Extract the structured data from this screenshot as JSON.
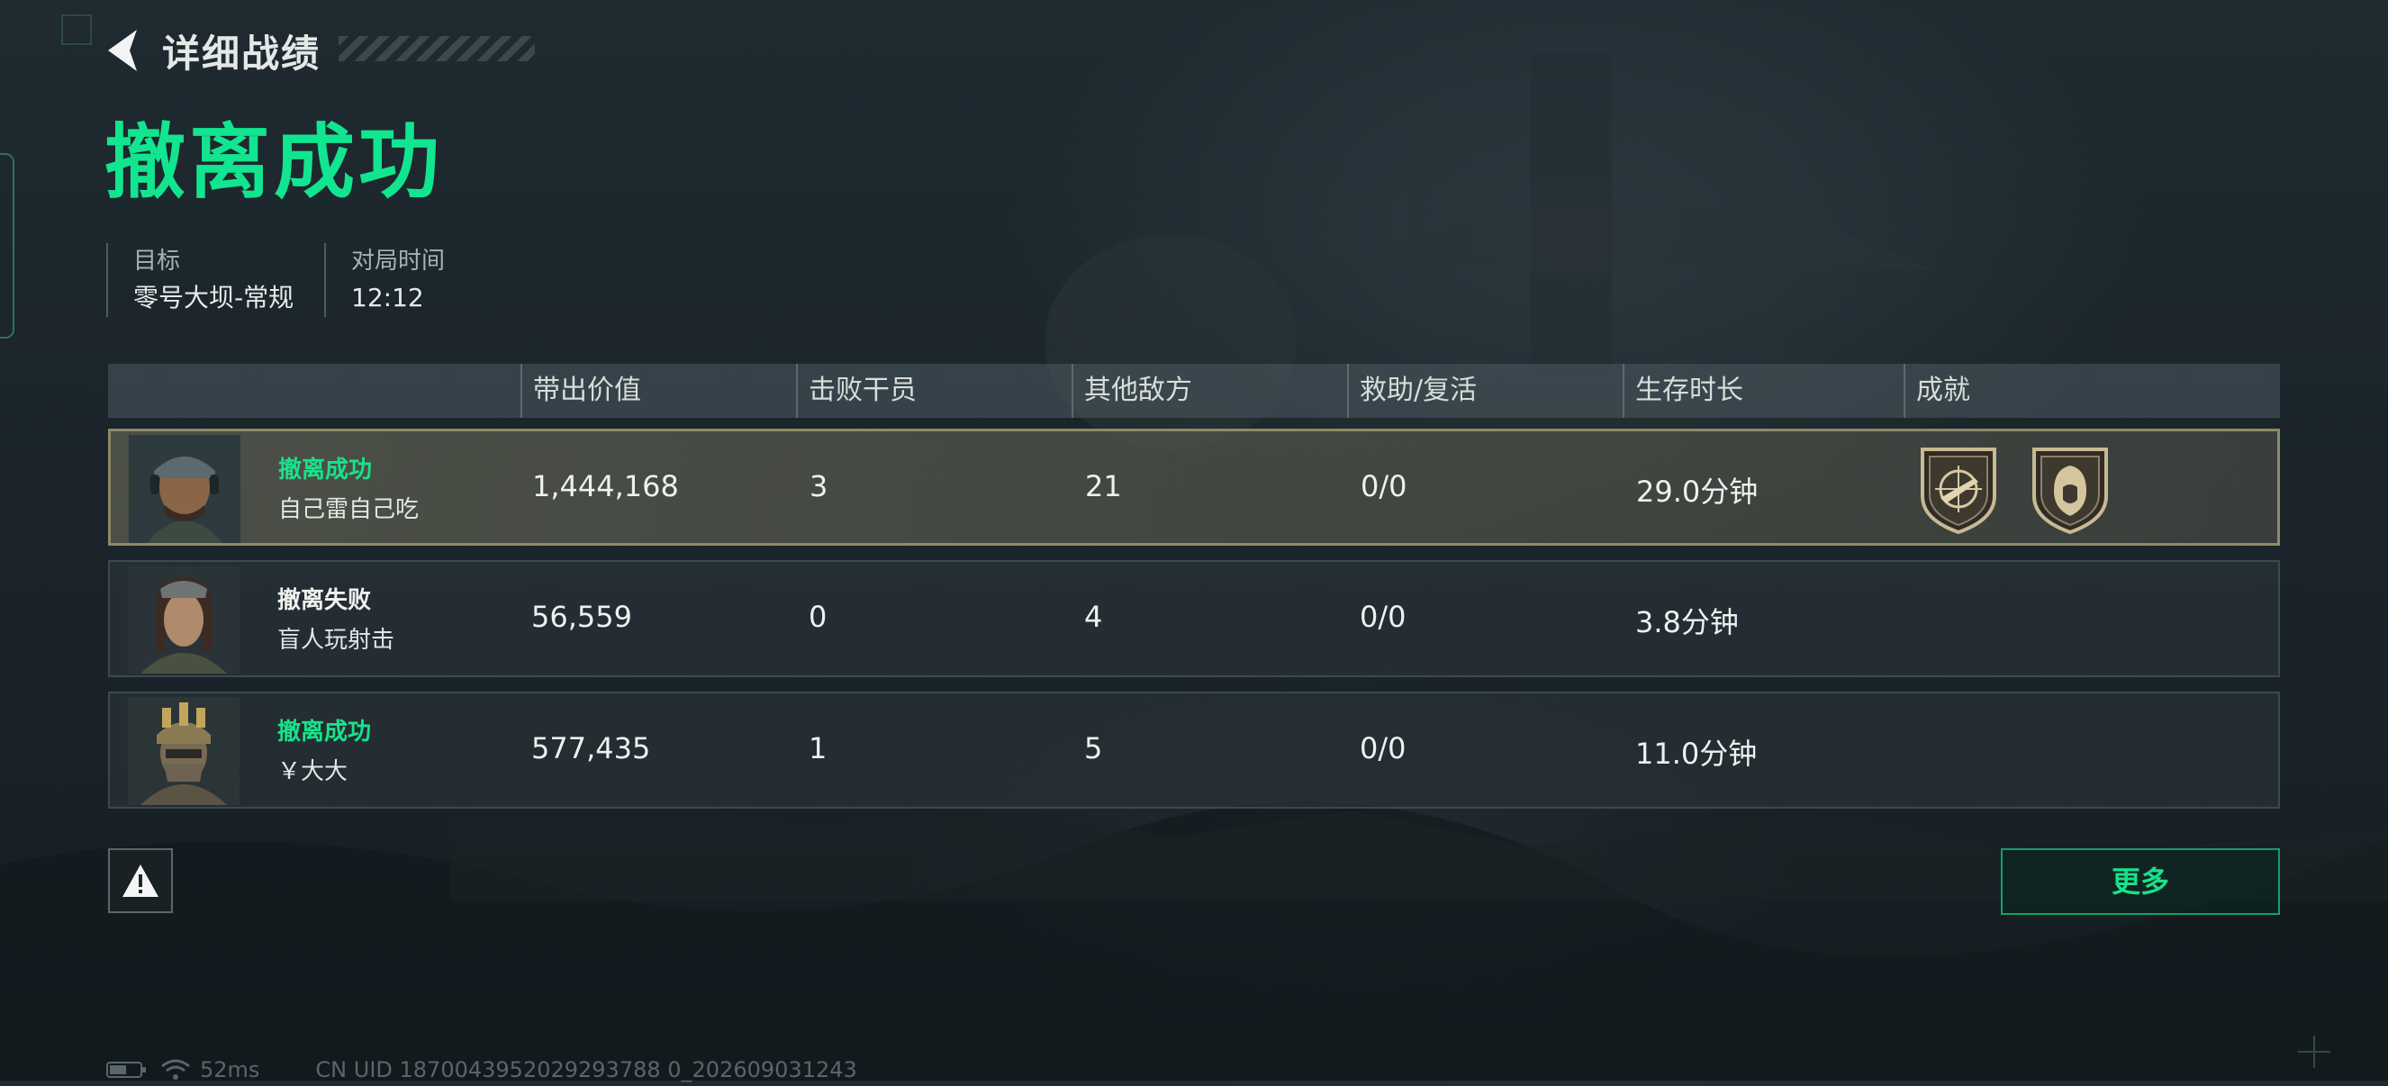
{
  "header": {
    "back_label": "详细战绩"
  },
  "result": {
    "title": "撤离成功"
  },
  "info": [
    {
      "label": "目标",
      "value": "零号大坝-常规"
    },
    {
      "label": "对局时间",
      "value": "12:12"
    }
  ],
  "table": {
    "columns": [
      "带出价值",
      "击败干员",
      "其他敌方",
      "救助/复活",
      "生存时长",
      "成就"
    ],
    "rows": [
      {
        "status": "撤离成功",
        "name": "自己雷自己吃",
        "value": "1,444,168",
        "kills": "3",
        "other": "21",
        "assist": "0/0",
        "survival": "29.0分钟",
        "achievements": [
          "rifle-crosshair-badge",
          "operator-hood-badge"
        ]
      },
      {
        "status": "撤离失败",
        "name": "盲人玩射击",
        "value": "56,559",
        "kills": "0",
        "other": "4",
        "assist": "0/0",
        "survival": "3.8分钟",
        "achievements": []
      },
      {
        "status": "撤离成功",
        "name": "￥大大",
        "value": "577,435",
        "kills": "1",
        "other": "5",
        "assist": "0/0",
        "survival": "11.0分钟",
        "achievements": []
      }
    ]
  },
  "buttons": {
    "more_label": "更多"
  },
  "footer": {
    "ping": "52ms",
    "uid": "CN UID 1870043952029293788 0_202609031243"
  },
  "colors": {
    "accent_green": "#12e58f",
    "highlight_border": "#8f8a67",
    "background": "#1a242a"
  }
}
